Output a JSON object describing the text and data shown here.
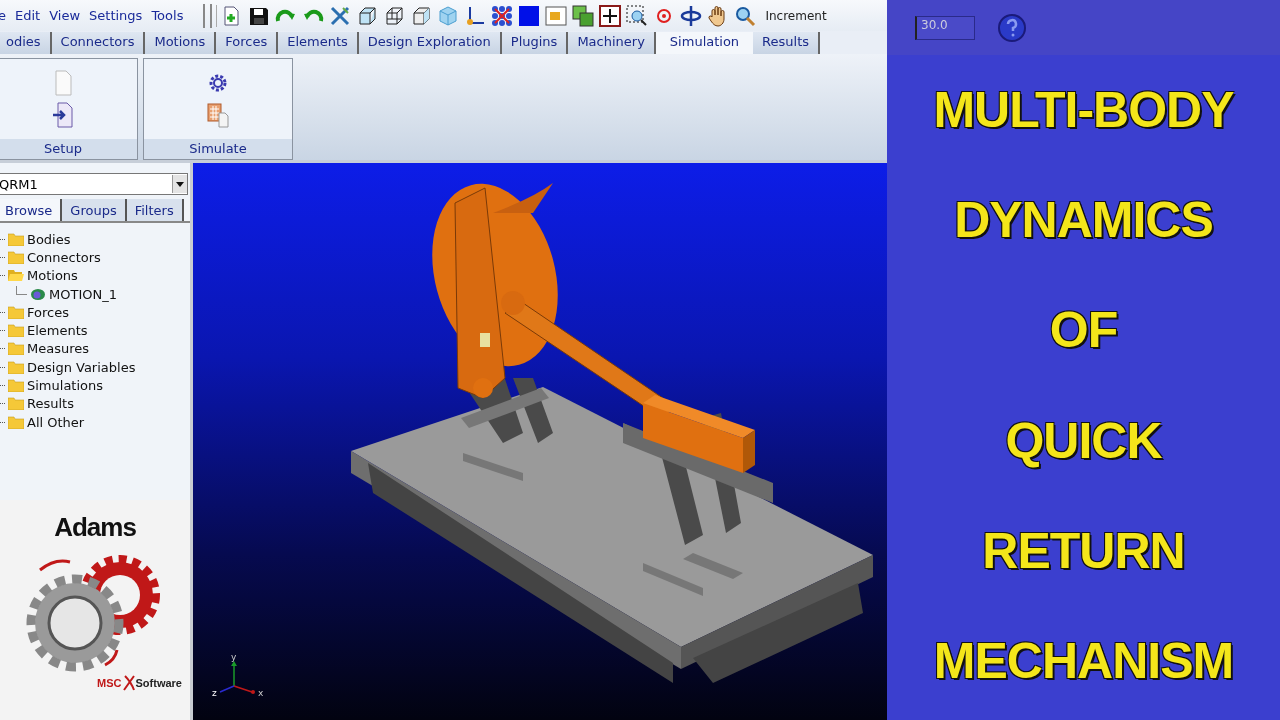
{
  "menu": [
    "e",
    "Edit",
    "View",
    "Settings",
    "Tools"
  ],
  "toolbar": {
    "increment_label": "Increment",
    "increment_value": "30.0"
  },
  "tabs": [
    {
      "label": "odies",
      "selected": false
    },
    {
      "label": "Connectors",
      "selected": false
    },
    {
      "label": "Motions",
      "selected": false
    },
    {
      "label": "Forces",
      "selected": false
    },
    {
      "label": "Elements",
      "selected": false
    },
    {
      "label": "Design Exploration",
      "selected": false
    },
    {
      "label": "Plugins",
      "selected": false
    },
    {
      "label": "Machinery",
      "selected": false
    },
    {
      "label": "Simulation",
      "selected": true
    },
    {
      "label": "Results",
      "selected": false
    }
  ],
  "ribbon": [
    {
      "label": "Setup",
      "kind": "setup"
    },
    {
      "label": "Simulate",
      "kind": "simulate"
    }
  ],
  "browser": {
    "model": "QRM1",
    "tabs": [
      {
        "label": "Browse",
        "selected": true
      },
      {
        "label": "Groups",
        "selected": false
      },
      {
        "label": "Filters",
        "selected": false
      }
    ],
    "tree": [
      {
        "label": "Bodies",
        "expanded": false
      },
      {
        "label": "Connectors",
        "expanded": false
      },
      {
        "label": "Motions",
        "expanded": true,
        "children": [
          {
            "label": "MOTION_1"
          }
        ]
      },
      {
        "label": "Forces",
        "expanded": false
      },
      {
        "label": "Elements",
        "expanded": false
      },
      {
        "label": "Measures",
        "expanded": false
      },
      {
        "label": "Design Variables",
        "expanded": false
      },
      {
        "label": "Simulations",
        "expanded": false
      },
      {
        "label": "Results",
        "expanded": false
      },
      {
        "label": "All Other",
        "expanded": false
      }
    ]
  },
  "logo": {
    "product": "Adams",
    "vendor_prefix": "MSC",
    "vendor_suffix": "Software"
  },
  "viewport": {
    "axes": [
      "y",
      "z",
      "x"
    ]
  },
  "title_lines": [
    "MULTI-BODY",
    "DYNAMICS",
    "OF",
    "QUICK",
    "RETURN",
    "MECHANISM"
  ]
}
